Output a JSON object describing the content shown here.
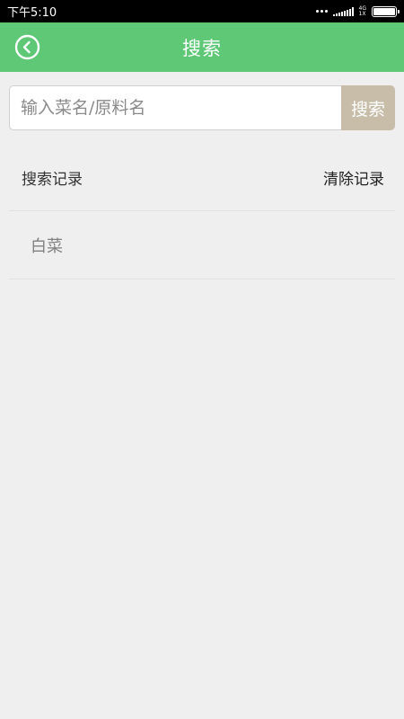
{
  "status_bar": {
    "time": "下午5:10",
    "network_top": "4G",
    "network_bottom": "1X"
  },
  "header": {
    "title": "搜索",
    "accent_color": "#5ec877"
  },
  "search": {
    "placeholder": "输入菜名/原料名",
    "value": "",
    "button_label": "搜索",
    "button_color": "#c8bda9"
  },
  "history": {
    "title": "搜索记录",
    "clear_label": "清除记录",
    "items": [
      {
        "label": "白菜"
      }
    ]
  },
  "icons": {
    "back": "back-circle-icon",
    "signal": "signal-icon",
    "battery": "battery-icon"
  }
}
